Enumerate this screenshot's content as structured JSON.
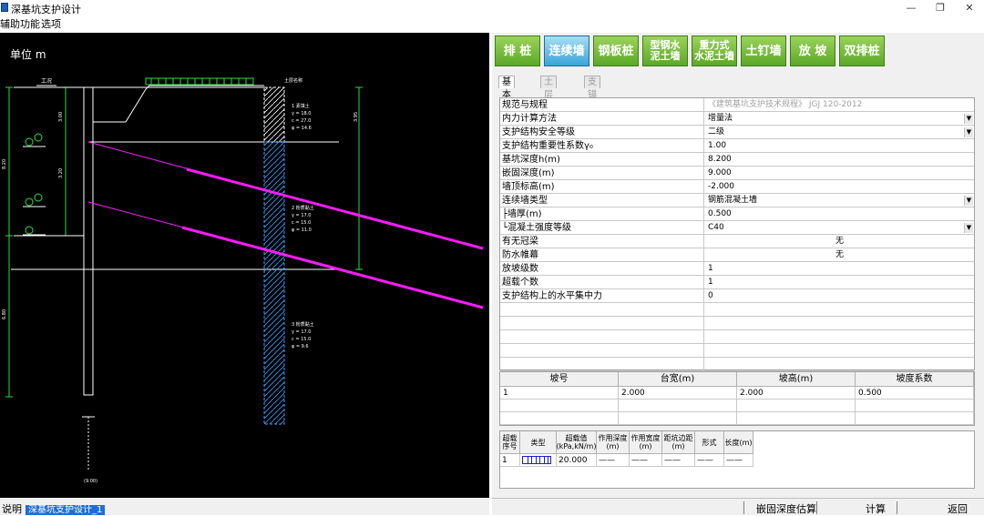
{
  "window": {
    "title": "深基坑支护设计",
    "minimize": "—",
    "restore": "❐",
    "close": "✕"
  },
  "menu": [
    "辅助功能",
    "选项"
  ],
  "canvas": {
    "unit_label": "单位 m",
    "labels": {
      "ground": "工况",
      "soil_layer": "土层名称",
      "layer1": [
        "1 素填土",
        "γ = 18.0",
        "c = 27.0",
        "φ = 14.6"
      ],
      "layer2": [
        "2 粉质黏土",
        "γ = 17.0",
        "c = 15.0",
        "φ = 11.0"
      ],
      "layer3": [
        "3 粉质黏土",
        "γ = 17.0",
        "c = 15.0",
        "φ = 9.6"
      ],
      "dims": [
        "3.00",
        "3.20",
        "8.20",
        "9.00",
        "3.95",
        "6.80",
        "(9.00)"
      ]
    }
  },
  "status": {
    "label": "说明",
    "value": "深基坑支护设计_1"
  },
  "toolbar": [
    {
      "label": "排 桩",
      "active": false
    },
    {
      "label": "连续墙",
      "active": true
    },
    {
      "label": "钢板桩",
      "active": false
    },
    {
      "label": "型钢水泥土墙",
      "line1": "型钢水",
      "line2": "泥土墙",
      "active": false
    },
    {
      "label": "重力式水泥土墙",
      "line1": "重力式",
      "line2": "水泥土墙",
      "active": false
    },
    {
      "label": "土钉墙",
      "active": false
    },
    {
      "label": "放 坡",
      "active": false
    },
    {
      "label": "双排桩",
      "active": false
    }
  ],
  "tabs": [
    "基本信息",
    "土层信息",
    "支锚信息"
  ],
  "properties": [
    {
      "name": "规范与规程",
      "value": "《建筑基坑支护技术规程》 JGJ 120-2012",
      "style": "grey"
    },
    {
      "name": "内力计算方法",
      "value": "增量法",
      "dropdown": true
    },
    {
      "name": "支护结构安全等级",
      "value": "二级",
      "dropdown": true
    },
    {
      "name": "支护结构重要性系数γ₀",
      "value": "1.00"
    },
    {
      "name": "基坑深度h(m)",
      "value": "8.200"
    },
    {
      "name": "嵌固深度(m)",
      "value": "9.000"
    },
    {
      "name": "墙顶标高(m)",
      "value": "-2.000"
    },
    {
      "name": "连续墙类型",
      "value": "钢筋混凝土墙",
      "dropdown": true
    },
    {
      "name": "  ├墙厚(m)",
      "value": "0.500"
    },
    {
      "name": "  └混凝土强度等级",
      "value": "C40",
      "dropdown": true
    },
    {
      "name": "有无冠梁",
      "value": "无",
      "style": "centered"
    },
    {
      "name": "防水帷幕",
      "value": "无",
      "style": "centered"
    },
    {
      "name": "放坡级数",
      "value": "1"
    },
    {
      "name": "超载个数",
      "value": "1"
    },
    {
      "name": "支护结构上的水平集中力",
      "value": "0"
    }
  ],
  "slope_table": {
    "headers": [
      "坡号",
      "台宽(m)",
      "坡高(m)",
      "坡度系数"
    ],
    "rows": [
      [
        "1",
        "2.000",
        "2.000",
        "0.500"
      ]
    ]
  },
  "load_table": {
    "headers": [
      "超载序号",
      "类型",
      "超载值(kPa,kN/m)",
      "作用深度(m)",
      "作用宽度(m)",
      "距坑边距(m)",
      "形式",
      "长度(m)"
    ],
    "rows": [
      [
        "1",
        "",
        "20.000",
        "——",
        "——",
        "——",
        "——",
        "——"
      ]
    ]
  },
  "bottom_buttons": [
    "嵌固深度估算",
    "计算",
    "返回"
  ]
}
